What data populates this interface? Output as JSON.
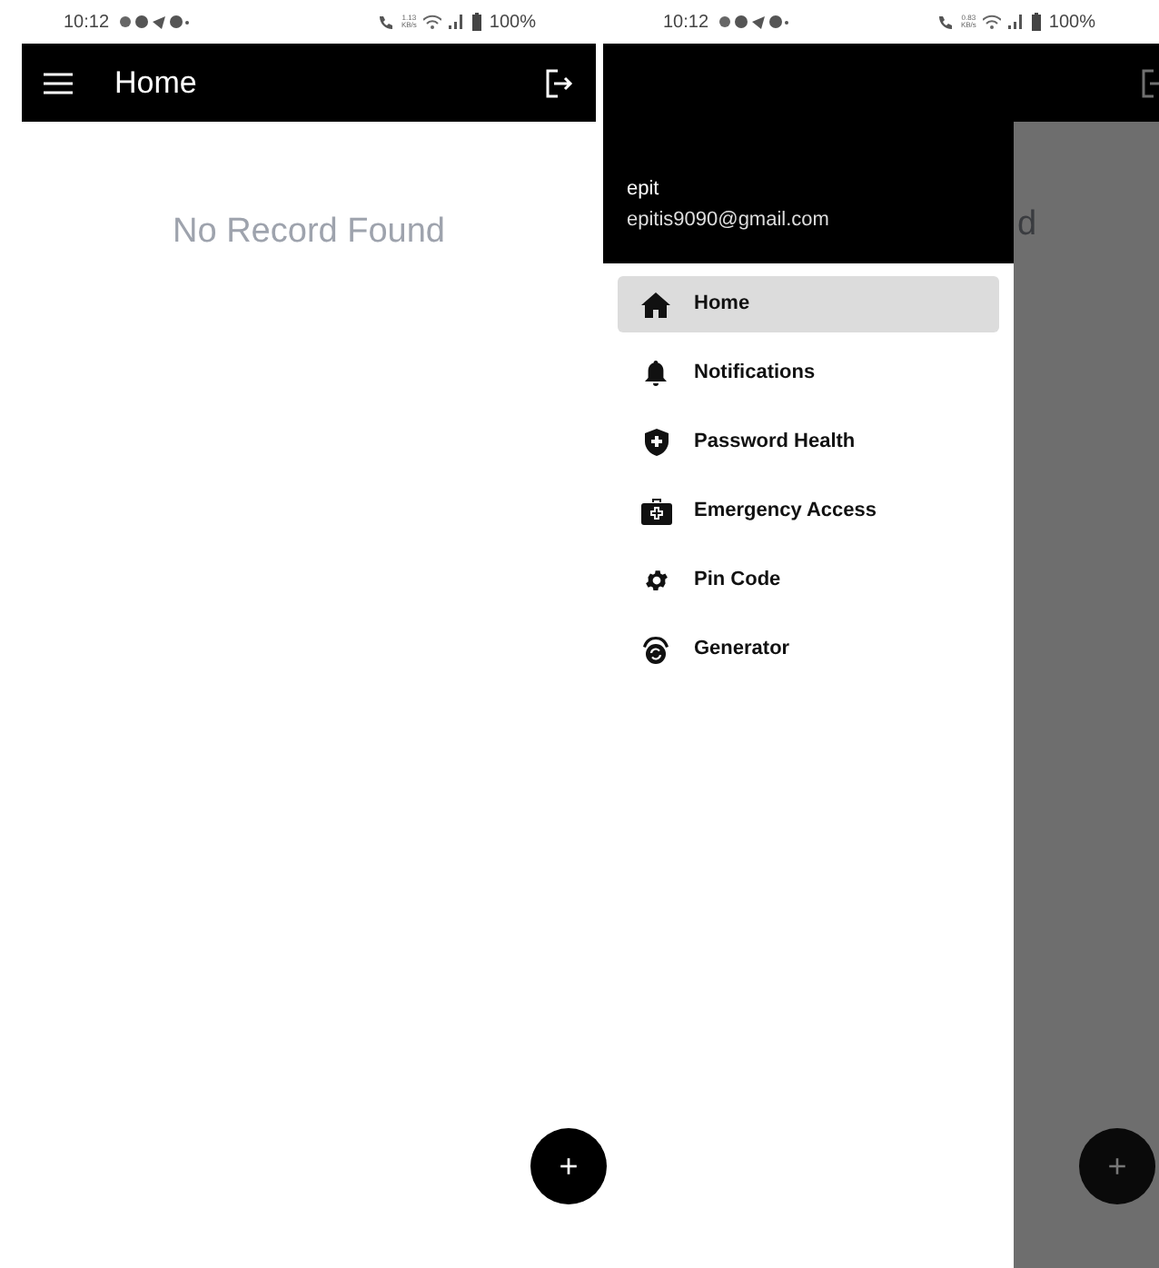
{
  "screens": [
    {
      "status_bar": {
        "time": "10:12",
        "speed": "1.13",
        "speed_unit": "KB/s",
        "battery": "100%"
      },
      "app_bar": {
        "title": "Home"
      },
      "empty_message": "No Record Found",
      "fab": "+"
    },
    {
      "status_bar": {
        "time": "10:12",
        "speed": "0.83",
        "speed_unit": "KB/s",
        "battery": "100%"
      },
      "drawer": {
        "user_name": "epit",
        "email": "epitis9090@gmail.com",
        "items": [
          {
            "kind": "home",
            "label": "Home",
            "selected": true
          },
          {
            "kind": "bell",
            "label": "Notifications",
            "selected": false
          },
          {
            "kind": "shield",
            "label": "Password Health",
            "selected": false
          },
          {
            "kind": "kit",
            "label": "Emergency Access",
            "selected": false
          },
          {
            "kind": "gear",
            "label": "Pin Code",
            "selected": false
          },
          {
            "kind": "generator",
            "label": "Generator",
            "selected": false
          }
        ]
      },
      "behind": {
        "message_fragment": "d",
        "fab": "+"
      }
    }
  ]
}
